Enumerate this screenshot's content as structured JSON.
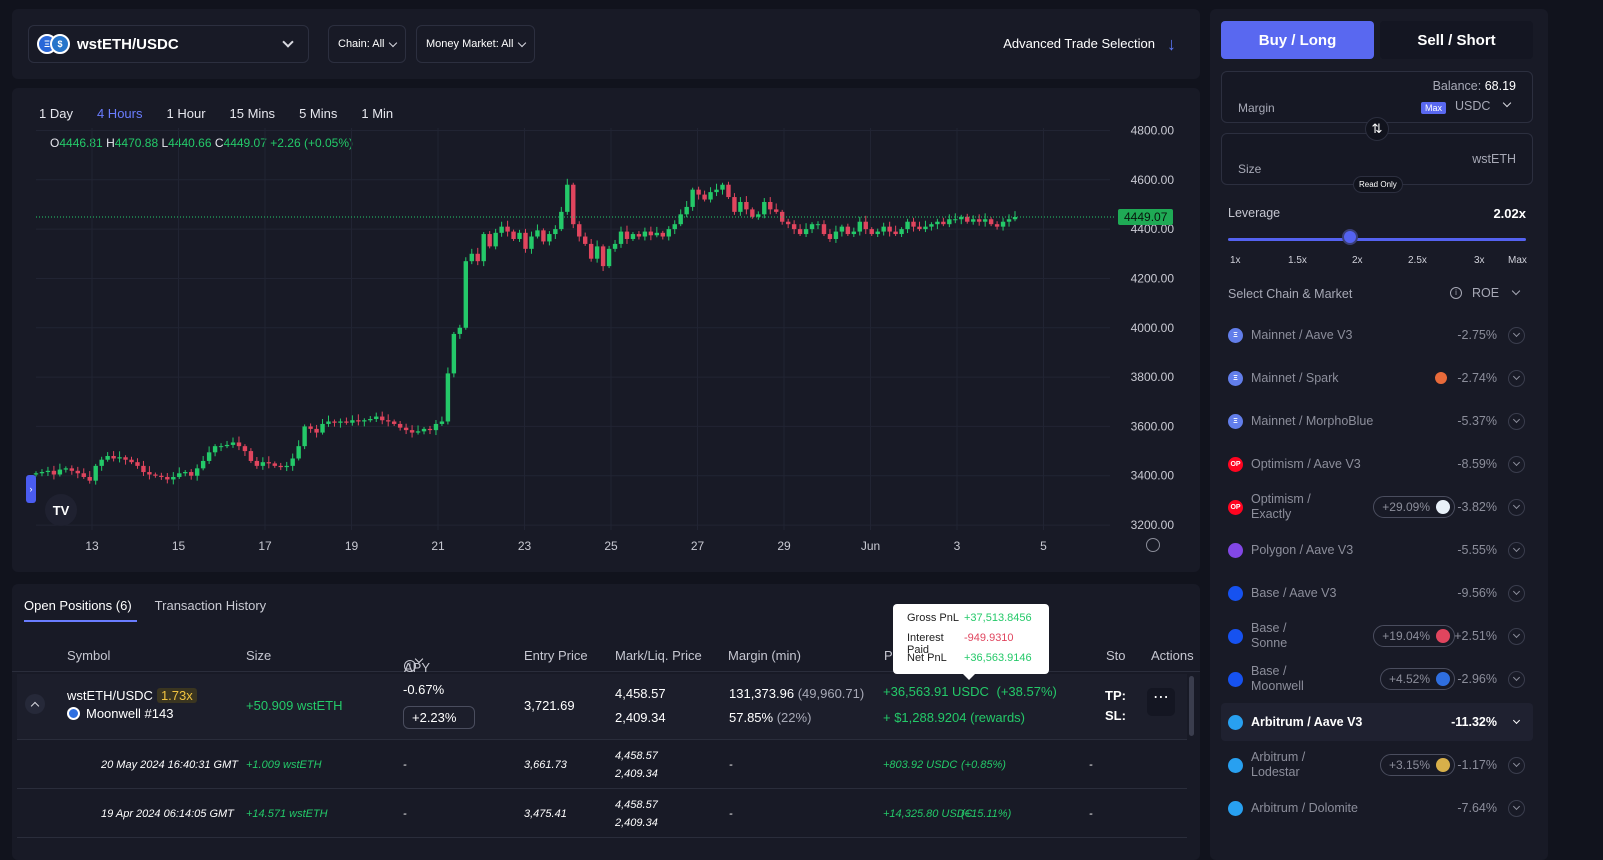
{
  "topbar": {
    "pair": "wstETH/USDC",
    "chain_filter": "Chain: All",
    "market_filter": "Money Market: All",
    "advanced": "Advanced Trade Selection"
  },
  "chart": {
    "timeframes": [
      "1 Day",
      "4 Hours",
      "1 Hour",
      "15 Mins",
      "5 Mins",
      "1 Min"
    ],
    "active_timeframe": "4 Hours",
    "ohlc": {
      "o": "4446.81",
      "h": "4470.88",
      "l": "4440.66",
      "c": "4449.07",
      "change": "+2.26 (+0.05%)"
    },
    "last_price": "4449.07",
    "y_ticks": [
      "4800.00",
      "4600.00",
      "4400.00",
      "4200.00",
      "4000.00",
      "3800.00",
      "3600.00",
      "3400.00",
      "3200.00"
    ],
    "x_ticks": [
      "13",
      "15",
      "17",
      "19",
      "21",
      "23",
      "25",
      "27",
      "29",
      "Jun",
      "3",
      "5"
    ],
    "colors": {
      "up": "#24c969",
      "down": "#e0455e"
    }
  },
  "chart_data": {
    "type": "candlestick",
    "ylim": [
      3180,
      4810
    ],
    "y_ticks": [
      4800,
      4600,
      4400,
      4200,
      4000,
      3800,
      3600,
      3400,
      3200
    ],
    "x_ticks": [
      "13",
      "15",
      "17",
      "19",
      "21",
      "23",
      "25",
      "27",
      "29",
      "Jun",
      "3",
      "5"
    ],
    "last_close": 4449.07,
    "closes": [
      3410,
      3415,
      3420,
      3405,
      3425,
      3430,
      3420,
      3410,
      3395,
      3380,
      3440,
      3465,
      3480,
      3470,
      3475,
      3465,
      3455,
      3440,
      3415,
      3405,
      3400,
      3395,
      3385,
      3395,
      3410,
      3415,
      3400,
      3430,
      3460,
      3495,
      3520,
      3520,
      3525,
      3535,
      3520,
      3500,
      3460,
      3440,
      3455,
      3450,
      3440,
      3435,
      3440,
      3470,
      3520,
      3600,
      3590,
      3575,
      3610,
      3620,
      3615,
      3620,
      3615,
      3625,
      3620,
      3625,
      3630,
      3640,
      3625,
      3620,
      3610,
      3595,
      3585,
      3575,
      3580,
      3590,
      3585,
      3610,
      3620,
      3815,
      3975,
      4000,
      4270,
      4300,
      4270,
      4380,
      4330,
      4385,
      4410,
      4390,
      4360,
      4385,
      4320,
      4370,
      4395,
      4350,
      4380,
      4400,
      4470,
      4580,
      4420,
      4370,
      4340,
      4280,
      4330,
      4250,
      4320,
      4340,
      4390,
      4360,
      4380,
      4370,
      4390,
      4375,
      4385,
      4370,
      4400,
      4420,
      4460,
      4490,
      4560,
      4540,
      4520,
      4550,
      4560,
      4580,
      4530,
      4470,
      4510,
      4480,
      4450,
      4460,
      4510,
      4480,
      4470,
      4430,
      4420,
      4400,
      4380,
      4400,
      4420,
      4420,
      4380,
      4360,
      4390,
      4410,
      4380,
      4390,
      4430,
      4400,
      4380,
      4390,
      4410,
      4390,
      4380,
      4400,
      4430,
      4410,
      4400,
      4410,
      4420,
      4430,
      4420,
      4440,
      4440,
      4450,
      4430,
      4440,
      4430,
      4440,
      4420,
      4410,
      4430,
      4440,
      4449
    ]
  },
  "positions": {
    "tabs": [
      "Open Positions (6)",
      "Transaction History"
    ],
    "headers": [
      "Symbol",
      "Size",
      "APY",
      "Entry Price",
      "Mark/Liq. Price",
      "Margin (min)",
      "P",
      "Sto",
      "Actions"
    ],
    "main": {
      "symbol": "wstETH/USDC",
      "leverage": "1.73x",
      "market": "Moonwell #143",
      "size": "+50.909 wstETH",
      "apy": "-0.67%",
      "apy_reward": "+2.23%",
      "entry": "3,721.69",
      "mark": "4,458.57",
      "liq": "2,409.34",
      "margin": "131,373.96",
      "margin_min": "(49,960.71)",
      "margin_pct": "57.85%",
      "margin_pct_min": "(22%)",
      "pnl": "+36,563.91 USDC",
      "pnl_pct": "(+38.57%)",
      "rewards": "+ $1,288.9204 (rewards)",
      "tp": "TP:",
      "sl": "SL:",
      "more": "⋯"
    },
    "subrows": [
      {
        "date": "20 May 2024 16:40:31 GMT",
        "size": "+1.009 wstETH",
        "apy": "-",
        "entry": "3,661.73",
        "mark": "4,458.57",
        "liq": "2,409.34",
        "margin": "-",
        "pnl": "+803.92 USDC",
        "pnl_pct": "(+0.85%)",
        "stop": "-"
      },
      {
        "date": "19 Apr 2024 06:14:05 GMT",
        "size": "+14.571 wstETH",
        "apy": "-",
        "entry": "3,475.41",
        "mark": "4,458.57",
        "liq": "2,409.34",
        "margin": "-",
        "pnl": "+14,325.80 USDC",
        "pnl_pct": "(+15.11%)",
        "stop": "-"
      }
    ]
  },
  "tooltip": {
    "gross_label": "Gross PnL",
    "gross": "+37,513.8456",
    "interest_label": "Interest Paid",
    "interest": "-949.9310",
    "net_label": "Net PnL",
    "net": "+36,563.9146"
  },
  "trade": {
    "buy": "Buy / Long",
    "sell": "Sell / Short",
    "balance_label": "Balance:",
    "balance": "68.19",
    "margin_label": "Margin",
    "max": "Max",
    "margin_token": "USDC",
    "size_label": "Size",
    "size_token": "wstETH",
    "read_only": "Read Only",
    "leverage_label": "Leverage",
    "leverage": "2.02x",
    "leverage_value": 2.02,
    "slider_marks": [
      "1x",
      "1.5x",
      "2x",
      "2.5x",
      "3x",
      "Max"
    ],
    "select_label": "Select Chain & Market",
    "sort_label": "ROE",
    "markets": [
      {
        "name": "Mainnet / Aave V3",
        "roe": "-2.75%",
        "icon": "eth-icon",
        "color": "#627eea"
      },
      {
        "name": "Mainnet / Spark",
        "roe": "-2.74%",
        "icon": "eth-icon",
        "color": "#627eea",
        "badge": "spark-icon"
      },
      {
        "name": "Mainnet / MorphoBlue",
        "roe": "-5.37%",
        "icon": "eth-icon",
        "color": "#627eea"
      },
      {
        "name": "Optimism / Aave V3",
        "roe": "-8.59%",
        "icon": "op-icon",
        "color": "#ff0420"
      },
      {
        "name": "Optimism / Exactly",
        "roe": "-3.82%",
        "icon": "op-icon",
        "color": "#ff0420",
        "reward": "+29.09%",
        "reward_color": "#e8f0f8"
      },
      {
        "name": "Polygon / Aave V3",
        "roe": "-5.55%",
        "icon": "polygon-icon",
        "color": "#8247e5"
      },
      {
        "name": "Base / Aave V3",
        "roe": "-9.56%",
        "icon": "base-icon",
        "color": "#1652f0"
      },
      {
        "name": "Base / Sonne",
        "roe": "+2.51%",
        "icon": "base-icon",
        "color": "#1652f0",
        "reward": "+19.04%",
        "reward_color": "#e0455e"
      },
      {
        "name": "Base / Moonwell",
        "roe": "-2.96%",
        "icon": "base-icon",
        "color": "#1652f0",
        "reward": "+4.52%",
        "reward_color": "#2f6fe0"
      },
      {
        "name": "Arbitrum / Aave V3",
        "roe": "-11.32%",
        "icon": "arbitrum-icon",
        "color": "#28a0f0",
        "selected": true
      },
      {
        "name": "Arbitrum / Lodestar",
        "roe": "-1.17%",
        "icon": "arbitrum-icon",
        "color": "#28a0f0",
        "reward": "+3.15%",
        "reward_color": "#d8b04a"
      },
      {
        "name": "Arbitrum / Dolomite",
        "roe": "-7.64%",
        "icon": "arbitrum-icon",
        "color": "#28a0f0"
      }
    ]
  }
}
